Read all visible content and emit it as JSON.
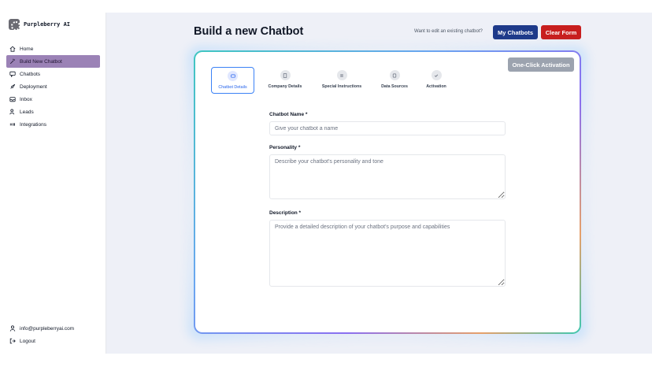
{
  "app": {
    "name": "Purpleberry AI"
  },
  "sidebar": {
    "items": [
      {
        "label": "Home",
        "icon": "home-icon"
      },
      {
        "label": "Build New Chatbot",
        "icon": "wand-icon",
        "active": true
      },
      {
        "label": "Chatbots",
        "icon": "chat-icon"
      },
      {
        "label": "Deployment",
        "icon": "rocket-icon"
      },
      {
        "label": "Inbox",
        "icon": "inbox-icon"
      },
      {
        "label": "Leads",
        "icon": "users-icon"
      },
      {
        "label": "Integrations",
        "icon": "integrations-icon"
      }
    ],
    "user_email": "info@purpleberryai.com",
    "logout": "Logout"
  },
  "header": {
    "title": "Build a new Chatbot",
    "edit_hint": "Want to edit an existing chatbot?",
    "my_chatbots": "My Chatbots",
    "clear_form": "Clear Form"
  },
  "card": {
    "activation_button": "One-Click Activation",
    "steps": [
      {
        "label": "Chatbot Details",
        "active": true
      },
      {
        "label": "Company Details"
      },
      {
        "label": "Special Instructions"
      },
      {
        "label": "Data Sources"
      },
      {
        "label": "Activation"
      }
    ]
  },
  "form": {
    "name_label": "Chatbot Name *",
    "name_placeholder": "Give your chatbot a name",
    "personality_label": "Personality *",
    "personality_placeholder": "Describe your chatbot's personality and tone",
    "description_label": "Description *",
    "description_placeholder": "Provide a detailed description of your chatbot's purpose and capabilities"
  },
  "colors": {
    "accent_active_nav": "#9b82b6",
    "my_chatbots_bg": "#1e3a8a",
    "clear_form_bg": "#c81e1e",
    "activation_bg": "#9ca3af",
    "active_step": "#3b82f6"
  }
}
